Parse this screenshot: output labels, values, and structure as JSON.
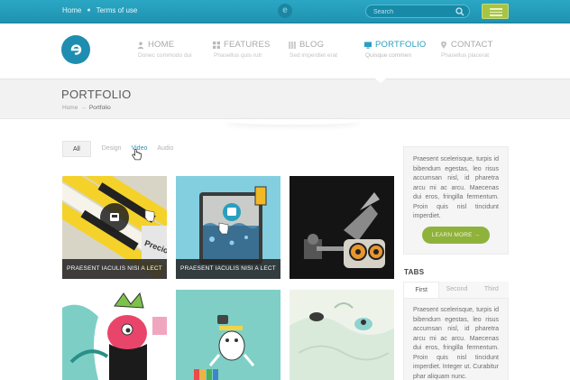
{
  "topbar": {
    "links": [
      "Home",
      "Terms of use"
    ],
    "search_placeholder": "Search",
    "logo_letter": "e"
  },
  "nav": [
    {
      "label": "HOME",
      "sub": "Donec commodo dui",
      "icon": "user-icon"
    },
    {
      "label": "FEATURES",
      "sub": "Phasellus quis rutr",
      "icon": "grid-icon"
    },
    {
      "label": "BLOG",
      "sub": "Sed imperdiet erat",
      "icon": "columns-icon"
    },
    {
      "label": "PORTFOLIO",
      "sub": "Quisque commen",
      "icon": "monitor-icon",
      "active": true
    },
    {
      "label": "CONTACT",
      "sub": "Phasellus placerat",
      "icon": "location-pin-icon"
    }
  ],
  "page": {
    "title": "PORTFOLIO",
    "breadcrumb": [
      "Home",
      "Portfolio"
    ],
    "breadcrumb_sep": "→"
  },
  "filters": [
    "All",
    "Design",
    "Video",
    "Audio"
  ],
  "portfolio": {
    "captions": [
      "PRAESENT IACULIS NISI A LECT",
      "PRAESENT IACULIS NISI A LECT"
    ]
  },
  "sidebar": {
    "text": "Praesent scelerisque, turpis id bibendum egestas, leo risus accumsan nisl, id pharetra arcu mi ac arcu. Maecenas dui eros, fringilla fermentum. Proin quis nisl tincidunt imperdiet.",
    "button": "LEARN MORE →",
    "tabs_title": "TABS",
    "tabs": [
      "First",
      "Second",
      "Third"
    ],
    "tab_text": "Praesent scelerisque, turpis id bibendum egestas, leo risus accumsan nisl, id pharetra arcu mi ac arcu. Maecenas dui eros, fringilla fermentum. Proin quis nisl tincidunt imperdiet. Integer ut. Curabitur phar aliquam nunc."
  },
  "colors": {
    "topbar": "#2aa7c4",
    "accent": "#2a9fc0",
    "button": "#8fb23b",
    "menu": "#a7c446"
  }
}
